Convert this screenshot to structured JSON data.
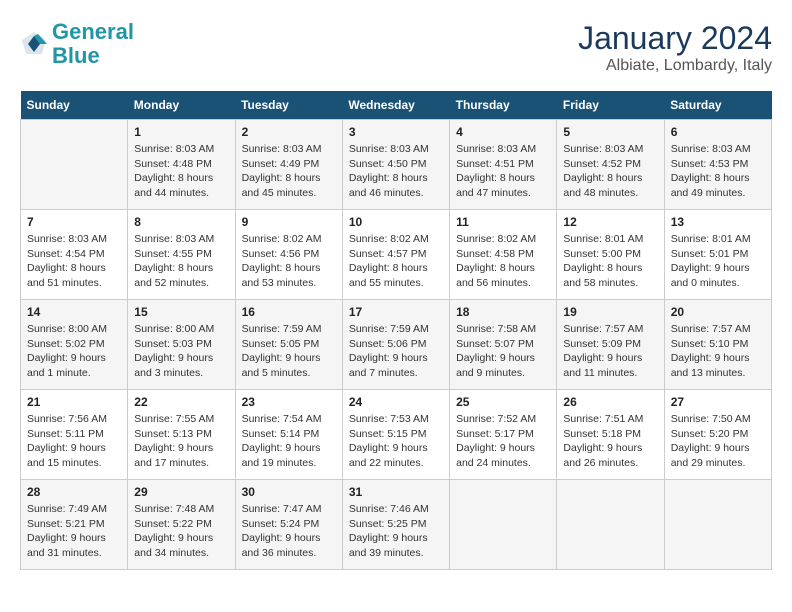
{
  "header": {
    "logo_line1": "General",
    "logo_line2": "Blue",
    "main_title": "January 2024",
    "subtitle": "Albiate, Lombardy, Italy"
  },
  "days_of_week": [
    "Sunday",
    "Monday",
    "Tuesday",
    "Wednesday",
    "Thursday",
    "Friday",
    "Saturday"
  ],
  "weeks": [
    [
      {
        "day": "",
        "info": ""
      },
      {
        "day": "1",
        "info": "Sunrise: 8:03 AM\nSunset: 4:48 PM\nDaylight: 8 hours\nand 44 minutes."
      },
      {
        "day": "2",
        "info": "Sunrise: 8:03 AM\nSunset: 4:49 PM\nDaylight: 8 hours\nand 45 minutes."
      },
      {
        "day": "3",
        "info": "Sunrise: 8:03 AM\nSunset: 4:50 PM\nDaylight: 8 hours\nand 46 minutes."
      },
      {
        "day": "4",
        "info": "Sunrise: 8:03 AM\nSunset: 4:51 PM\nDaylight: 8 hours\nand 47 minutes."
      },
      {
        "day": "5",
        "info": "Sunrise: 8:03 AM\nSunset: 4:52 PM\nDaylight: 8 hours\nand 48 minutes."
      },
      {
        "day": "6",
        "info": "Sunrise: 8:03 AM\nSunset: 4:53 PM\nDaylight: 8 hours\nand 49 minutes."
      }
    ],
    [
      {
        "day": "7",
        "info": "Sunrise: 8:03 AM\nSunset: 4:54 PM\nDaylight: 8 hours\nand 51 minutes."
      },
      {
        "day": "8",
        "info": "Sunrise: 8:03 AM\nSunset: 4:55 PM\nDaylight: 8 hours\nand 52 minutes."
      },
      {
        "day": "9",
        "info": "Sunrise: 8:02 AM\nSunset: 4:56 PM\nDaylight: 8 hours\nand 53 minutes."
      },
      {
        "day": "10",
        "info": "Sunrise: 8:02 AM\nSunset: 4:57 PM\nDaylight: 8 hours\nand 55 minutes."
      },
      {
        "day": "11",
        "info": "Sunrise: 8:02 AM\nSunset: 4:58 PM\nDaylight: 8 hours\nand 56 minutes."
      },
      {
        "day": "12",
        "info": "Sunrise: 8:01 AM\nSunset: 5:00 PM\nDaylight: 8 hours\nand 58 minutes."
      },
      {
        "day": "13",
        "info": "Sunrise: 8:01 AM\nSunset: 5:01 PM\nDaylight: 9 hours\nand 0 minutes."
      }
    ],
    [
      {
        "day": "14",
        "info": "Sunrise: 8:00 AM\nSunset: 5:02 PM\nDaylight: 9 hours\nand 1 minute."
      },
      {
        "day": "15",
        "info": "Sunrise: 8:00 AM\nSunset: 5:03 PM\nDaylight: 9 hours\nand 3 minutes."
      },
      {
        "day": "16",
        "info": "Sunrise: 7:59 AM\nSunset: 5:05 PM\nDaylight: 9 hours\nand 5 minutes."
      },
      {
        "day": "17",
        "info": "Sunrise: 7:59 AM\nSunset: 5:06 PM\nDaylight: 9 hours\nand 7 minutes."
      },
      {
        "day": "18",
        "info": "Sunrise: 7:58 AM\nSunset: 5:07 PM\nDaylight: 9 hours\nand 9 minutes."
      },
      {
        "day": "19",
        "info": "Sunrise: 7:57 AM\nSunset: 5:09 PM\nDaylight: 9 hours\nand 11 minutes."
      },
      {
        "day": "20",
        "info": "Sunrise: 7:57 AM\nSunset: 5:10 PM\nDaylight: 9 hours\nand 13 minutes."
      }
    ],
    [
      {
        "day": "21",
        "info": "Sunrise: 7:56 AM\nSunset: 5:11 PM\nDaylight: 9 hours\nand 15 minutes."
      },
      {
        "day": "22",
        "info": "Sunrise: 7:55 AM\nSunset: 5:13 PM\nDaylight: 9 hours\nand 17 minutes."
      },
      {
        "day": "23",
        "info": "Sunrise: 7:54 AM\nSunset: 5:14 PM\nDaylight: 9 hours\nand 19 minutes."
      },
      {
        "day": "24",
        "info": "Sunrise: 7:53 AM\nSunset: 5:15 PM\nDaylight: 9 hours\nand 22 minutes."
      },
      {
        "day": "25",
        "info": "Sunrise: 7:52 AM\nSunset: 5:17 PM\nDaylight: 9 hours\nand 24 minutes."
      },
      {
        "day": "26",
        "info": "Sunrise: 7:51 AM\nSunset: 5:18 PM\nDaylight: 9 hours\nand 26 minutes."
      },
      {
        "day": "27",
        "info": "Sunrise: 7:50 AM\nSunset: 5:20 PM\nDaylight: 9 hours\nand 29 minutes."
      }
    ],
    [
      {
        "day": "28",
        "info": "Sunrise: 7:49 AM\nSunset: 5:21 PM\nDaylight: 9 hours\nand 31 minutes."
      },
      {
        "day": "29",
        "info": "Sunrise: 7:48 AM\nSunset: 5:22 PM\nDaylight: 9 hours\nand 34 minutes."
      },
      {
        "day": "30",
        "info": "Sunrise: 7:47 AM\nSunset: 5:24 PM\nDaylight: 9 hours\nand 36 minutes."
      },
      {
        "day": "31",
        "info": "Sunrise: 7:46 AM\nSunset: 5:25 PM\nDaylight: 9 hours\nand 39 minutes."
      },
      {
        "day": "",
        "info": ""
      },
      {
        "day": "",
        "info": ""
      },
      {
        "day": "",
        "info": ""
      }
    ]
  ]
}
